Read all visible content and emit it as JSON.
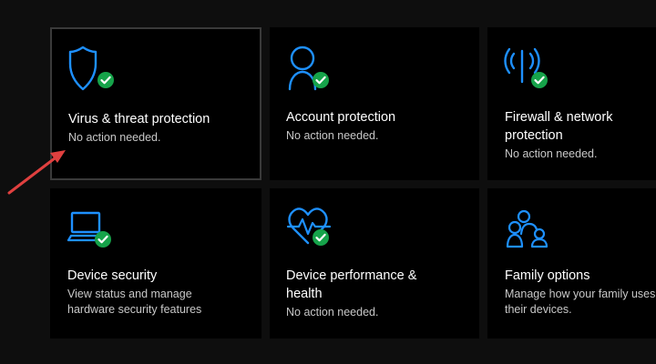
{
  "colors": {
    "accent": "#1e90ff",
    "check_badge": "#16a34a",
    "annotation_arrow": "#e0403f",
    "tile_background": "#000000",
    "page_background": "#0e0e0e"
  },
  "tiles": [
    {
      "icon": "shield-icon",
      "title": "Virus & threat protection",
      "desc": "No action needed.",
      "status_icon": "check-badge-icon",
      "focused": true
    },
    {
      "icon": "person-icon",
      "title": "Account protection",
      "desc": "No action needed.",
      "status_icon": "check-badge-icon",
      "focused": false
    },
    {
      "icon": "wifi-antenna-icon",
      "title": "Firewall & network protection",
      "desc": "No action needed.",
      "status_icon": "check-badge-icon",
      "focused": false
    },
    {
      "icon": "laptop-icon",
      "title": "Device security",
      "desc": "View status and manage hardware security features",
      "status_icon": "check-badge-icon",
      "focused": false
    },
    {
      "icon": "heart-pulse-icon",
      "title": "Device performance & health",
      "desc": "No action needed.",
      "status_icon": "check-badge-icon",
      "focused": false
    },
    {
      "icon": "family-icon",
      "title": "Family options",
      "desc": "Manage how your family uses their devices.",
      "status_icon": null,
      "focused": false
    }
  ]
}
